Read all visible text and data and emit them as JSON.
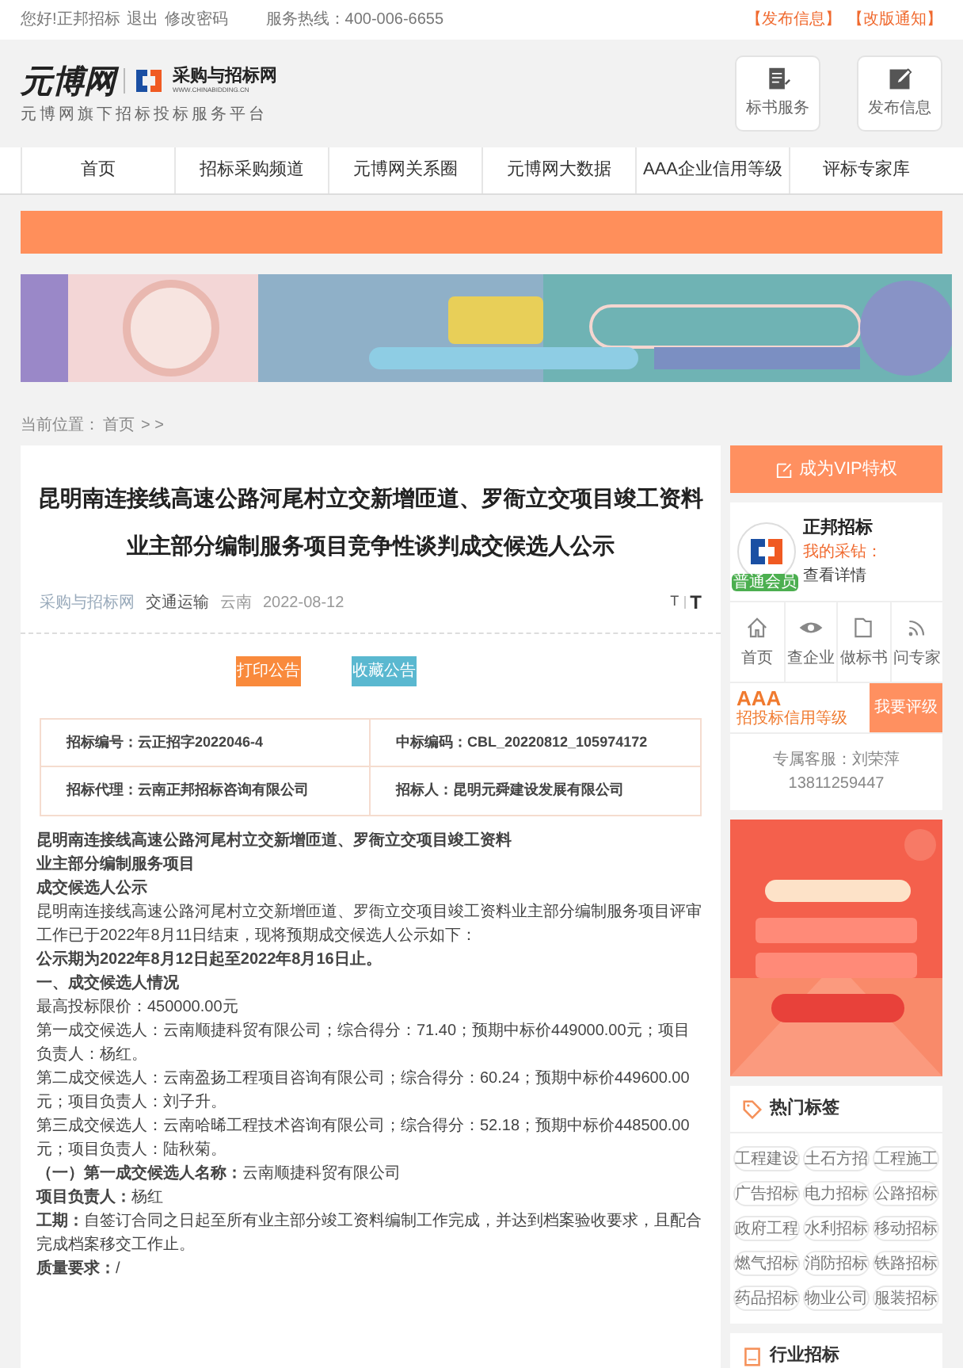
{
  "top_bar": {
    "greeting": "您好!正邦招标",
    "links": [
      "退出",
      "修改密码"
    ],
    "hotline": "服务热线：400-006-6655",
    "right_links": [
      "【发布信息】",
      "【改版通知】"
    ]
  },
  "header": {
    "logo_text": "元博网",
    "brand": "采购与招标网",
    "brand_url": "WWW.CHINABIDDING.CN",
    "tagline": "元博网旗下招标投标服务平台",
    "buttons": [
      {
        "label": "标书服务",
        "kind": "doc"
      },
      {
        "label": "发布信息",
        "kind": "edit"
      }
    ]
  },
  "nav": [
    "首页",
    "招标采购频道",
    "元博网关系圈",
    "元博网大数据",
    "AAA企业信用等级",
    "评标专家库"
  ],
  "breadcrumb": {
    "label": "当前位置：",
    "link": "首页",
    "tail": "> >"
  },
  "article": {
    "title": "昆明南连接线高速公路河尾村立交新增匝道、罗衙立交项目竣工资料业主部分编制服务项目竞争性谈判成交候选人公示",
    "meta": [
      "采购与招标网",
      "交通运输",
      "云南",
      "2022-08-12"
    ],
    "font_toggles": [
      "T",
      "T"
    ],
    "buttons": [
      {
        "label": "打印公告",
        "kind": "print"
      },
      {
        "label": "收藏公告",
        "kind": "save"
      }
    ],
    "info": [
      "招标编号：云正招字2022046-4",
      "中标编码：CBL_20220812_105974172",
      "招标代理：云南正邦招标咨询有限公司",
      "招标人：昆明元舜建设发展有限公司"
    ],
    "body": [
      {
        "text": "昆明南连接线高速公路河尾村立交新增匝道、罗衙立交项目竣工资料",
        "bold": true
      },
      {
        "text": "业主部分编制服务项目",
        "bold": true
      },
      {
        "text": "成交候选人公示",
        "bold": true
      },
      {
        "text": "昆明南连接线高速公路河尾村立交新增匝道、罗衙立交项目竣工资料业主部分编制服务项目评审工作已于2022年8月11日结束，现将预期成交候选人公示如下：",
        "bold": false
      },
      {
        "text": "公示期为2022年8月12日起至2022年8月16日止。",
        "bold": true
      },
      {
        "text": "一、成交候选人情况",
        "bold": true
      },
      {
        "text": "最高投标限价：450000.00元",
        "bold": false
      },
      {
        "text": "第一成交候选人：云南顺捷科贸有限公司；综合得分：71.40；预期中标价449000.00元；项目负责人：杨红。",
        "bold": false
      },
      {
        "text": "第二成交候选人：云南盈扬工程项目咨询有限公司；综合得分：60.24；预期中标价449600.00元；项目负责人：刘子升。",
        "bold": false
      },
      {
        "text": "第三成交候选人：云南哈晞工程技术咨询有限公司；综合得分：52.18；预期中标价448500.00元；项目负责人：陆秋菊。",
        "bold": false
      },
      {
        "text": "**（一）第一成交候选人名称：**云南顺捷科贸有限公司",
        "bold": false
      },
      {
        "text": "**项目负责人：**杨红",
        "bold": false
      },
      {
        "text": "**工期：**自签订合同之日起至所有业主部分竣工资料编制工作完成，并达到档案验收要求，且配合完成档案移交工作止。",
        "bold": false
      },
      {
        "text": "**质量要求：**/",
        "bold": false
      }
    ]
  },
  "sidebar": {
    "vip_button": "成为VIP特权",
    "profile": {
      "name": "正邦招标",
      "badge": "普通会员",
      "wallet_label": "我的采钻：",
      "wallet_link": "查看详情"
    },
    "quick_links": [
      {
        "label": "首页",
        "kind": "home"
      },
      {
        "label": "查企业",
        "kind": "eye"
      },
      {
        "label": "做标书",
        "kind": "file"
      },
      {
        "label": "问专家",
        "kind": "rss"
      }
    ],
    "credit": {
      "grade": "AAA",
      "label": "招投标信用等级",
      "button": "我要评级"
    },
    "service": "专属客服：刘荣萍 13811259447",
    "hot_tags": {
      "title": "热门标签",
      "tags": [
        "工程建设",
        "土石方招",
        "工程施工",
        "广告招标",
        "电力招标",
        "公路招标",
        "政府工程",
        "水利招标",
        "移动招标",
        "燃气招标",
        "消防招标",
        "铁路招标",
        "药品招标",
        "物业公司",
        "服装招标"
      ]
    },
    "industry": {
      "title": "行业招标"
    }
  }
}
